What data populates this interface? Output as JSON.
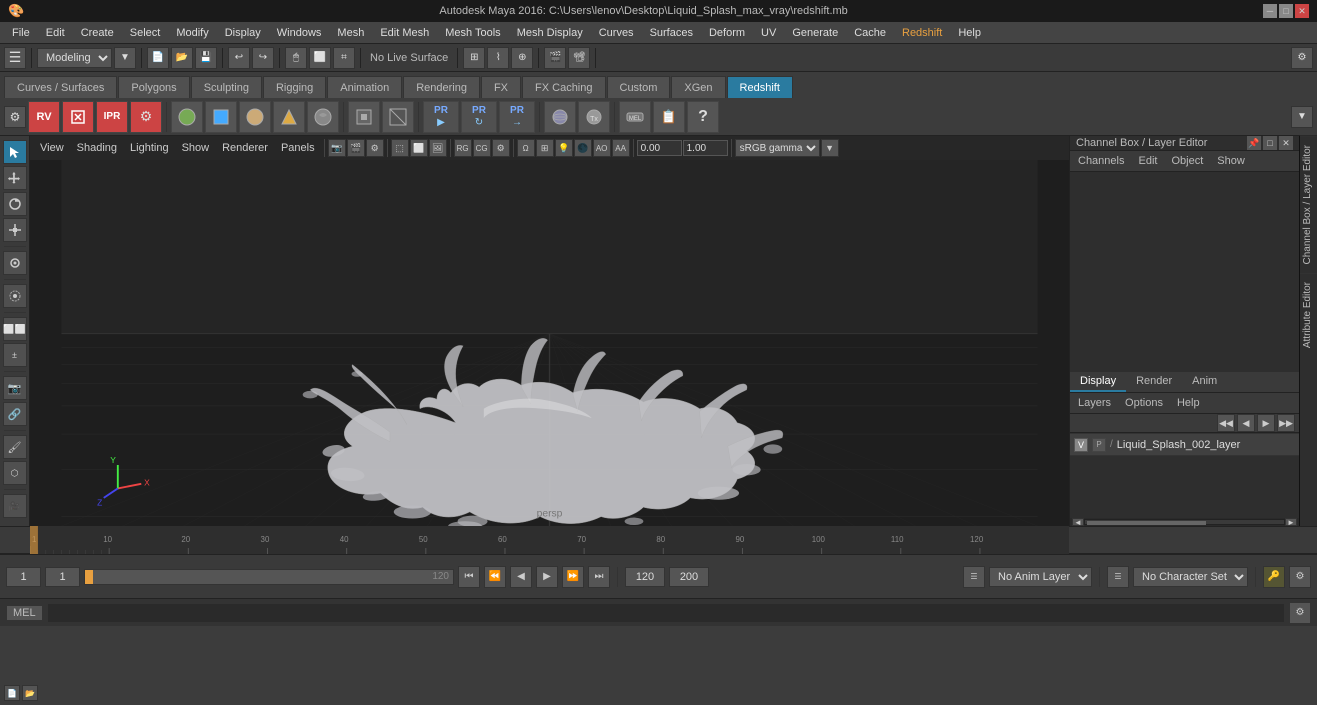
{
  "titlebar": {
    "text": "Autodesk Maya 2016: C:\\Users\\lenov\\Desktop\\Liquid_Splash_max_vray\\redshift.mb",
    "min": "─",
    "max": "□",
    "close": "✕"
  },
  "menubar": {
    "items": [
      "File",
      "Edit",
      "Create",
      "Select",
      "Modify",
      "Display",
      "Windows",
      "Mesh",
      "Edit Mesh",
      "Mesh Tools",
      "Mesh Display",
      "Curves",
      "Surfaces",
      "Deform",
      "UV",
      "Generate",
      "Cache",
      "Redshift",
      "Help"
    ]
  },
  "toolbar1": {
    "workspace": "Modeling",
    "live_surface": "No Live Surface"
  },
  "tabs": {
    "items": [
      "Curves / Surfaces",
      "Polygons",
      "Sculpting",
      "Rigging",
      "Animation",
      "Rendering",
      "FX",
      "FX Caching",
      "Custom",
      "XGen",
      "Redshift"
    ]
  },
  "viewport": {
    "menus": [
      "View",
      "Shading",
      "Lighting",
      "Show",
      "Renderer",
      "Panels"
    ],
    "label": "persp",
    "color_mode": "sRGB gamma",
    "coord_x": "0.00",
    "coord_y": "1.00"
  },
  "right_panel": {
    "title": "Channel Box / Layer Editor",
    "tabs": [
      "Display",
      "Render",
      "Anim"
    ],
    "active_tab": "Display",
    "channel_menus": [
      "Channels",
      "Edit",
      "Object",
      "Show"
    ],
    "layer_menus": [
      "Layers",
      "Options",
      "Help"
    ],
    "layer": {
      "name": "Liquid_Splash_002_layer",
      "visible": "V",
      "type": "P"
    }
  },
  "side_tabs": [
    "Channel Box / Layer Editor",
    "Attribute Editor"
  ],
  "timeline": {
    "start": "1",
    "end": "120",
    "current": "1",
    "ticks": [
      "1",
      "10",
      "20",
      "30",
      "40",
      "50",
      "60",
      "70",
      "80",
      "90",
      "100",
      "110",
      "120"
    ],
    "tick_values": [
      1,
      10,
      20,
      30,
      40,
      50,
      60,
      70,
      80,
      90,
      100,
      110,
      120
    ]
  },
  "playback": {
    "frame_start": "1",
    "frame_current": "1",
    "frame_slider": "1",
    "frame_end_input": "120",
    "range_end": "120",
    "range_max": "200",
    "anim_layer": "No Anim Layer",
    "char_set": "No Character Set",
    "buttons": [
      "⏮",
      "⏪",
      "◀",
      "▶",
      "▶▶",
      "⏩",
      "⏭"
    ]
  },
  "bottombar": {
    "tag": "MEL",
    "input_placeholder": ""
  },
  "shelf_icons": {
    "group1": [
      "🔵",
      "⬜",
      "🔶",
      "🟡",
      "🟤"
    ],
    "group2": [
      "⬛",
      "🔲"
    ],
    "group3": [
      "💧",
      "🟠",
      "🟤"
    ],
    "group4": [
      "🔴",
      "🔴"
    ],
    "pr1": {
      "top": "PR",
      "bot": "▶"
    },
    "pr2": {
      "top": "PR",
      "bot": "⟳"
    },
    "pr3": {
      "top": "PR",
      "bot": "⇥"
    }
  },
  "icons": {
    "settings": "⚙",
    "arrow_up": "▲",
    "arrow_down": "▼",
    "arrow_left": "◄",
    "arrow_right": "►",
    "play": "▶",
    "stop": "■",
    "rewind": "◄◄",
    "fast_forward": "►►",
    "skip_start": "|◄",
    "skip_end": "►|",
    "close": "✕",
    "gear": "⚙",
    "question": "?",
    "lock": "🔒"
  },
  "colors": {
    "accent": "#2a7ba0",
    "bg_dark": "#2e2e2e",
    "bg_mid": "#3c3c3c",
    "bg_light": "#505050",
    "text_main": "#cccccc",
    "grid_line": "#3a3a3a",
    "grid_dark": "#1e1e1e"
  }
}
